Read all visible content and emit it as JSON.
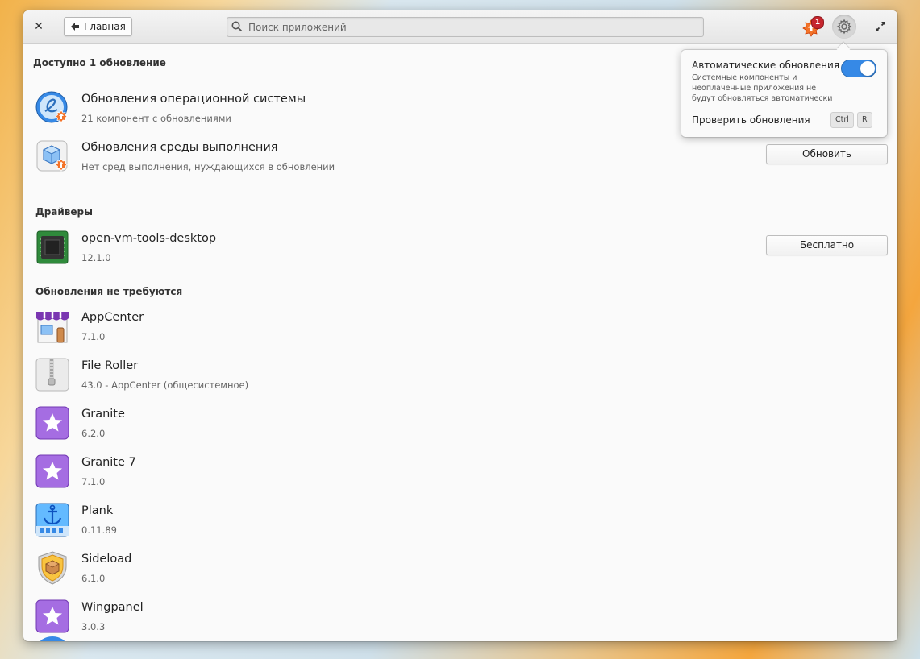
{
  "headerbar": {
    "home_label": "Главная",
    "search_placeholder": "Поиск приложений",
    "updates_badge": "1"
  },
  "sections": {
    "available": "Доступно 1 обновление",
    "drivers": "Драйверы",
    "up_to_date": "Обновления не требуются"
  },
  "available_items": [
    {
      "name": "Обновления операционной системы",
      "desc": "21 компонент с обновлениями",
      "button": ""
    },
    {
      "name": "Обновления среды выполнения",
      "desc": "Нет сред выполнения, нуждающихся в обновлении",
      "button": "Обновить"
    }
  ],
  "drivers": [
    {
      "name": "open-vm-tools-desktop",
      "desc": "12.1.0",
      "button": "Бесплатно"
    }
  ],
  "apps": [
    {
      "name": "AppCenter",
      "desc": "7.1.0"
    },
    {
      "name": "File Roller",
      "desc": "43.0 - AppCenter (общесистемное)"
    },
    {
      "name": "Granite",
      "desc": "6.2.0"
    },
    {
      "name": "Granite 7",
      "desc": "7.1.0"
    },
    {
      "name": "Plank",
      "desc": "0.11.89"
    },
    {
      "name": "Sideload",
      "desc": "6.1.0"
    },
    {
      "name": "Wingpanel",
      "desc": "3.0.3"
    }
  ],
  "popover": {
    "auto_title": "Автоматические обновления",
    "auto_sub": "Системные компоненты и неоплаченные приложения не будут обновляться автоматически",
    "auto_enabled": true,
    "check_label": "Проверить обновления",
    "key1": "Ctrl",
    "key2": "R"
  },
  "colors": {
    "accent": "#3689e6",
    "badge": "#c6262e",
    "update_orange": "#f37329",
    "granite_purple": "#a56de2"
  }
}
